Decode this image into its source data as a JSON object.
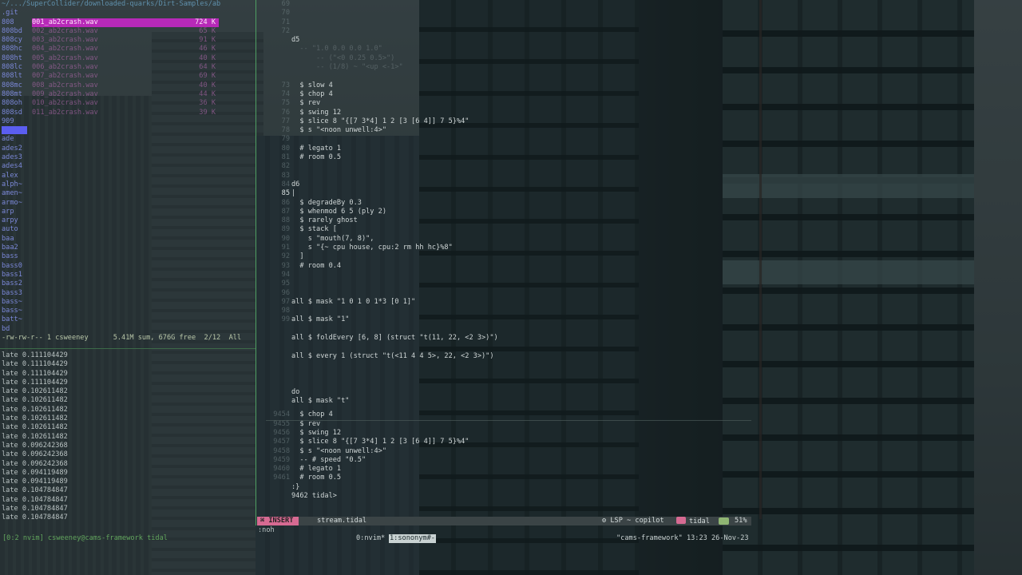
{
  "file_browser": {
    "path": "~/.../SuperCollider/downloaded-quarks/Dirt-Samples/ab",
    "entries": [
      {
        "dir": ".git",
        "file": "",
        "size": ""
      },
      {
        "dir": "808",
        "file": "001_ab2crash.wav",
        "size": "724 K",
        "selected": true
      },
      {
        "dir": "808bd",
        "file": "002_ab2crash.wav",
        "size": "65 K"
      },
      {
        "dir": "808cy",
        "file": "003_ab2crash.wav",
        "size": "91 K"
      },
      {
        "dir": "808hc",
        "file": "004_ab2crash.wav",
        "size": "46 K"
      },
      {
        "dir": "808ht",
        "file": "005_ab2crash.wav",
        "size": "40 K"
      },
      {
        "dir": "808lc",
        "file": "006_ab2crash.wav",
        "size": "64 K"
      },
      {
        "dir": "808lt",
        "file": "007_ab2crash.wav",
        "size": "69 K"
      },
      {
        "dir": "808mc",
        "file": "008_ab2crash.wav",
        "size": "40 K"
      },
      {
        "dir": "808mt",
        "file": "009_ab2crash.wav",
        "size": "44 K"
      },
      {
        "dir": "808oh",
        "file": "010_ab2crash.wav",
        "size": "36 K"
      },
      {
        "dir": "808sd",
        "file": "011_ab2crash.wav",
        "size": "39 K"
      },
      {
        "dir": "909",
        "file": "",
        "size": ""
      },
      {
        "dir": "",
        "file": "",
        "size": "",
        "cursor": true
      },
      {
        "dir": "ade",
        "file": "",
        "size": ""
      },
      {
        "dir": "ades2",
        "file": "",
        "size": ""
      },
      {
        "dir": "ades3",
        "file": "",
        "size": ""
      },
      {
        "dir": "ades4",
        "file": "",
        "size": ""
      },
      {
        "dir": "alex",
        "file": "",
        "size": ""
      },
      {
        "dir": "alph~",
        "file": "",
        "size": ""
      },
      {
        "dir": "amen~",
        "file": "",
        "size": ""
      },
      {
        "dir": "armo~",
        "file": "",
        "size": ""
      },
      {
        "dir": "arp",
        "file": "",
        "size": ""
      },
      {
        "dir": "arpy",
        "file": "",
        "size": ""
      },
      {
        "dir": "auto",
        "file": "",
        "size": ""
      },
      {
        "dir": "baa",
        "file": "",
        "size": ""
      },
      {
        "dir": "baa2",
        "file": "",
        "size": ""
      },
      {
        "dir": "bass",
        "file": "",
        "size": ""
      },
      {
        "dir": "bass0",
        "file": "",
        "size": ""
      },
      {
        "dir": "bass1",
        "file": "",
        "size": ""
      },
      {
        "dir": "bass2",
        "file": "",
        "size": ""
      },
      {
        "dir": "bass3",
        "file": "",
        "size": ""
      },
      {
        "dir": "bass~",
        "file": "",
        "size": ""
      },
      {
        "dir": "bass~",
        "file": "",
        "size": ""
      },
      {
        "dir": "batt~",
        "file": "",
        "size": ""
      },
      {
        "dir": "bd",
        "file": "",
        "size": ""
      }
    ],
    "status": "-rw-rw-r-- 1 csweeney      5.41M sum, 676G free  2/12  All"
  },
  "log_lines": [
    "late 0.111104429",
    "late 0.111104429",
    "late 0.111104429",
    "late 0.111104429",
    "late 0.102611482",
    "late 0.102611482",
    "late 0.102611482",
    "late 0.102611482",
    "late 0.102611482",
    "late 0.102611482",
    "late 0.096242368",
    "late 0.096242368",
    "late 0.096242368",
    "late 0.094119489",
    "late 0.094119489",
    "late 0.104784847",
    "late 0.104784847",
    "late 0.104784847",
    "late 0.104784847"
  ],
  "editor": {
    "lines": [
      {
        "n": "69",
        "t": "",
        "k": "dim"
      },
      {
        "n": "70",
        "t": "",
        "k": "dim"
      },
      {
        "n": "71",
        "t": "",
        "k": "dim"
      },
      {
        "n": "72",
        "t": "",
        "k": "dim"
      },
      {
        "n": "",
        "t": "d5",
        "k": "id"
      },
      {
        "n": "",
        "t": "  -- \"1.0 0.0 0.0 1.0\"",
        "k": "cm"
      },
      {
        "n": "",
        "t": "      -- (\"<0 0.25 0.5>\")",
        "k": "cm"
      },
      {
        "n": "",
        "t": "      -- (1/8) ~ \"<up <-1>\"",
        "k": "cm"
      },
      {
        "n": "",
        "t": "",
        "k": "dim"
      },
      {
        "n": "73",
        "t": "  $ slow 4",
        "k": "id"
      },
      {
        "n": "74",
        "t": "  $ chop 4",
        "k": "id"
      },
      {
        "n": "75",
        "t": "  $ rev",
        "k": "id"
      },
      {
        "n": "76",
        "t": "  $ swing 12",
        "k": "id"
      },
      {
        "n": "77",
        "t": "  $ slice 8 \"{[7 3*4] 1 2 [3 [6 4]] 7 5}%4\"",
        "k": "id"
      },
      {
        "n": "78",
        "t": "  $ s \"<noon unwell:4>\"",
        "k": "id"
      },
      {
        "n": "79",
        "t": "",
        "k": "dim"
      },
      {
        "n": "80",
        "t": "  # legato 1",
        "k": "id"
      },
      {
        "n": "81",
        "t": "  # room 0.5",
        "k": "id"
      },
      {
        "n": "82",
        "t": "",
        "k": "dim"
      },
      {
        "n": "83",
        "t": "",
        "k": "dim"
      },
      {
        "n": "84",
        "t": "d6",
        "k": "id"
      },
      {
        "n": "85",
        "t": "|",
        "k": "cur"
      },
      {
        "n": "86",
        "t": "  $ degradeBy 0.3",
        "k": "id"
      },
      {
        "n": "87",
        "t": "  $ whenmod 6 5 (ply 2)",
        "k": "id"
      },
      {
        "n": "88",
        "t": "  $ rarely ghost",
        "k": "id"
      },
      {
        "n": "89",
        "t": "  $ stack [",
        "k": "id"
      },
      {
        "n": "90",
        "t": "    s \"mouth(7, 8)\",",
        "k": "id"
      },
      {
        "n": "91",
        "t": "    s \"{~ cpu house, cpu:2 rm hh hc}%8\"",
        "k": "id"
      },
      {
        "n": "92",
        "t": "  ]",
        "k": "id"
      },
      {
        "n": "93",
        "t": "  # room 0.4",
        "k": "id"
      },
      {
        "n": "94",
        "t": "",
        "k": "dim"
      },
      {
        "n": "95",
        "t": "",
        "k": "dim"
      },
      {
        "n": "96",
        "t": "",
        "k": "dim"
      },
      {
        "n": "97",
        "t": "all $ mask \"1 0 1 0 1*3 [0 1]\"",
        "k": "id"
      },
      {
        "n": "98",
        "t": "",
        "k": "dim"
      },
      {
        "n": "99",
        "t": "all $ mask \"1\"",
        "k": "id"
      },
      {
        "n": "",
        "t": "",
        "k": "dim"
      },
      {
        "n": "",
        "t": "all $ foldEvery [6, 8] (struct \"t(11, 22, <2 3>)\")",
        "k": "id"
      },
      {
        "n": "",
        "t": "",
        "k": "dim"
      },
      {
        "n": "",
        "t": "all $ every 1 (struct \"t(<11 4 4 5>, 22, <2 3>)\")",
        "k": "id"
      },
      {
        "n": "",
        "t": "",
        "k": "dim"
      },
      {
        "n": "",
        "t": "",
        "k": "dim"
      },
      {
        "n": "",
        "t": "",
        "k": "dim"
      },
      {
        "n": "",
        "t": "do",
        "k": "id"
      },
      {
        "n": "",
        "t": "all $ mask \"t\"",
        "k": "id"
      }
    ],
    "output_lines": [
      {
        "n": "9454",
        "t": "  $ chop 4"
      },
      {
        "n": "9455",
        "t": "  $ rev"
      },
      {
        "n": "9456",
        "t": "  $ swing 12"
      },
      {
        "n": "9457",
        "t": "  $ slice 8 \"{[7 3*4] 1 2 [3 [6 4]] 7 5}%4\""
      },
      {
        "n": "9458",
        "t": "  $ s \"<noon unwell:4>\""
      },
      {
        "n": "9459",
        "t": "  -- # speed \"0.5\""
      },
      {
        "n": "9460",
        "t": "  # legato 1"
      },
      {
        "n": "9461",
        "t": "  # room 0.5"
      },
      {
        "n": "",
        "t": ":}"
      },
      {
        "n": "",
        "t": "9462 tidal>"
      }
    ]
  },
  "statusbar": {
    "mode": "INSERT",
    "file": "stream.tidal",
    "lsp": "LSP ~ copilot",
    "filetype": "tidal",
    "percent": "51%"
  },
  "cmdline": ":noh",
  "tmux": {
    "left": "[0:2 nvim] csweeney@cams-framework tidal",
    "win0": "0:nvim*",
    "win1": "1:sononym#-",
    "right": "\"cams-framework\" 13:23 26-Nov-23"
  },
  "colors": {
    "accent_magenta": "#b729b8",
    "insert_mode": "#d66a92",
    "separator_green": "#4f9f62",
    "cursor_blue": "#5b5ef0"
  }
}
